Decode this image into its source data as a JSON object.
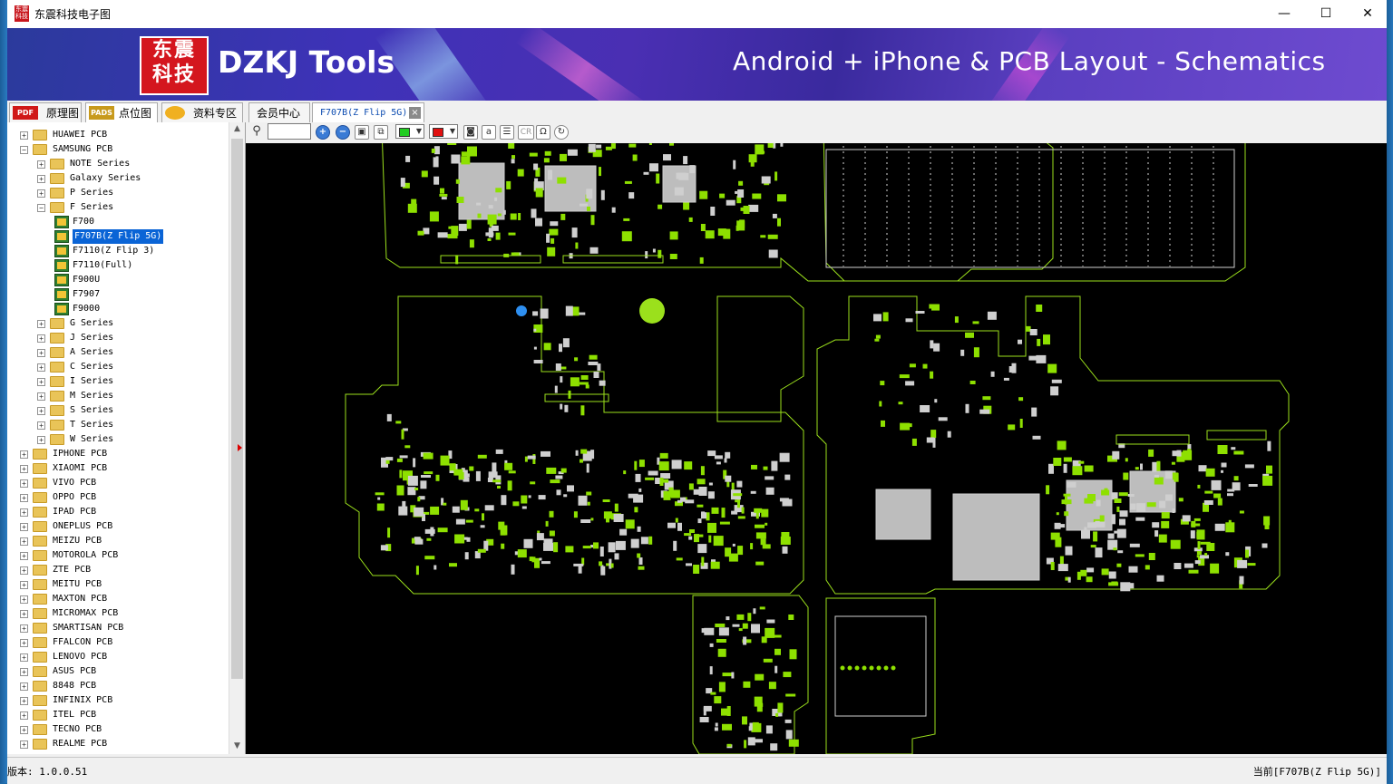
{
  "window": {
    "title": "东震科技电子图",
    "minimize": "—",
    "maximize": "☐",
    "close": "✕"
  },
  "banner": {
    "logo_text_top": "东震",
    "logo_text_bottom": "科技",
    "brand": "DZKJ Tools",
    "slogan": "Android + iPhone & PCB Layout - Schematics"
  },
  "tabs": [
    {
      "icon": "PDF",
      "label": "原理图"
    },
    {
      "icon": "PADS",
      "label": "点位图"
    },
    {
      "icon": "",
      "label": "资料专区"
    },
    {
      "icon": "",
      "label": "会员中心"
    },
    {
      "icon": "",
      "label": "F707B(Z Flip 5G)"
    }
  ],
  "tree": [
    {
      "label": "HUAWEI PCB",
      "expander": "+"
    },
    {
      "label": "SAMSUNG PCB",
      "expander": "−"
    },
    {
      "label": "NOTE Series",
      "expander": "+"
    },
    {
      "label": "Galaxy Series",
      "expander": "+"
    },
    {
      "label": "P Series",
      "expander": "+"
    },
    {
      "label": "F Series",
      "expander": "−"
    },
    {
      "label": "F700"
    },
    {
      "label": "F707B(Z Flip 5G)"
    },
    {
      "label": "F7110(Z Flip 3)"
    },
    {
      "label": "F7110(Full)"
    },
    {
      "label": "F900U"
    },
    {
      "label": "F7907"
    },
    {
      "label": "F9000"
    },
    {
      "label": "G Series",
      "expander": "+"
    },
    {
      "label": "J Series",
      "expander": "+"
    },
    {
      "label": "A Series",
      "expander": "+"
    },
    {
      "label": "C Series",
      "expander": "+"
    },
    {
      "label": "I Series",
      "expander": "+"
    },
    {
      "label": "M Series",
      "expander": "+"
    },
    {
      "label": "S Series",
      "expander": "+"
    },
    {
      "label": "T Series",
      "expander": "+"
    },
    {
      "label": "W Series",
      "expander": "+"
    },
    {
      "label": "IPHONE PCB",
      "expander": "+"
    },
    {
      "label": "XIAOMI PCB",
      "expander": "+"
    },
    {
      "label": "VIVO PCB",
      "expander": "+"
    },
    {
      "label": "OPPO PCB",
      "expander": "+"
    },
    {
      "label": "IPAD PCB",
      "expander": "+"
    },
    {
      "label": "ONEPLUS PCB",
      "expander": "+"
    },
    {
      "label": "MEIZU PCB",
      "expander": "+"
    },
    {
      "label": "MOTOROLA PCB",
      "expander": "+"
    },
    {
      "label": "ZTE PCB",
      "expander": "+"
    },
    {
      "label": "MEITU PCB",
      "expander": "+"
    },
    {
      "label": "MAXTON PCB",
      "expander": "+"
    },
    {
      "label": "MICROMAX PCB",
      "expander": "+"
    },
    {
      "label": "SMARTISAN PCB",
      "expander": "+"
    },
    {
      "label": "FFALCON PCB",
      "expander": "+"
    },
    {
      "label": "LENOVO PCB",
      "expander": "+"
    },
    {
      "label": "ASUS PCB",
      "expander": "+"
    },
    {
      "label": "8848 PCB",
      "expander": "+"
    },
    {
      "label": "INFINIX PCB",
      "expander": "+"
    },
    {
      "label": "ITEL PCB",
      "expander": "+"
    },
    {
      "label": "TECNO PCB",
      "expander": "+"
    },
    {
      "label": "REALME PCB",
      "expander": "+"
    }
  ],
  "toolbar": {
    "zoom_value": "",
    "zoom_in": "+",
    "zoom_out": "−",
    "color1": "#22cc22",
    "color2": "#e01010",
    "cr_label": "CR",
    "omega_label": "Ω"
  },
  "pcb": {
    "outline_color": "#9be01c",
    "pad_color": "#8ee000",
    "chip_color": "#bdbdbd",
    "marker_color": "#9be01c",
    "marker2_color": "#2e8ff0"
  },
  "status": {
    "version": "版本: 1.0.0.51",
    "current": "当前[F707B(Z Flip 5G)]"
  }
}
